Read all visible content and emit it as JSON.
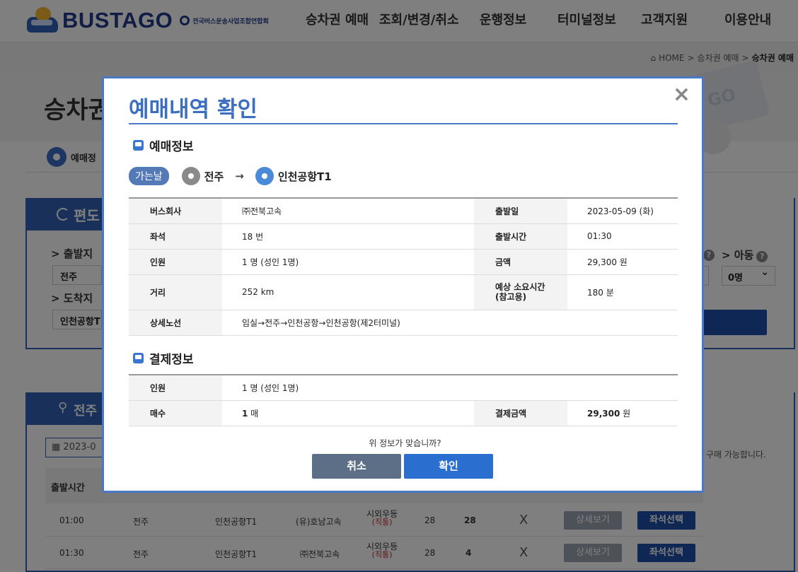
{
  "gnb": {
    "logo_text": "BUSTAGO",
    "logo_sub": "전국버스운송사업조합연합회",
    "menu": [
      "승차권 예매",
      "조회/변경/취소",
      "운행정보",
      "터미널정보",
      "고객지원",
      "이용안내"
    ]
  },
  "breadcrumb": {
    "home": "HOME",
    "level1": "승차권 예매",
    "current": "승차권 예매",
    "sep": ">"
  },
  "hero": {
    "title": "승차권",
    "ticket_text": "GO"
  },
  "step": {
    "label": "예매정"
  },
  "search": {
    "head": "편도",
    "departure_label": "> 출발지",
    "departure_value": "전주",
    "arrival_label": "> 도착지",
    "arrival_value": "인천공항T",
    "child_label": "> 아동",
    "child_select": "0명",
    "help": "?"
  },
  "result": {
    "head": "전주",
    "date_value": "2023-0",
    "note": "구매 가능합니다.",
    "header_first": "출발시간",
    "rows": [
      {
        "time": "01:00",
        "from": "전주",
        "to": "인천공항T1",
        "company": "(유)호남고속",
        "class1": "시외우등",
        "class2": "(직통)",
        "seats": "28",
        "remain": "28",
        "flag": "X",
        "detail": "상세보기",
        "select": "좌석선택"
      },
      {
        "time": "01:30",
        "from": "전주",
        "to": "인천공항T1",
        "company": "㈜전북고속",
        "class1": "시외우등",
        "class2": "(직통)",
        "seats": "28",
        "remain": "4",
        "flag": "X",
        "detail": "상세보기",
        "select": "좌석선택"
      }
    ]
  },
  "modal": {
    "title": "예매내역 확인",
    "close": "×",
    "section1": "예매정보",
    "trip_badge": "가는날",
    "origin": "전주",
    "arrow": "→",
    "destination": "인천공항T1",
    "booking": {
      "company_label": "버스회사",
      "company": "㈜전북고속",
      "date_label": "출발일",
      "date": "2023-05-09 (화)",
      "seat_label": "좌석",
      "seat": "18 번",
      "time_label": "출발시간",
      "time": "01:30",
      "people_label": "인원",
      "people": "1 명 (성인 1명)",
      "price_label": "금액",
      "price": "29,300 원",
      "distance_label": "거리",
      "distance": "252 km",
      "duration_label": "예상 소요시간",
      "duration_label2": "(참고용)",
      "duration": "180 분",
      "route_label": "상세노선",
      "route": "임실→전주→인천공항→인천공항(제2터미널)"
    },
    "section2": "결제정보",
    "payment": {
      "people_label": "인원",
      "people": "1 명 (성인 1명)",
      "count_label": "매수",
      "count": "1",
      "count_unit": " 매",
      "amount_label": "결제금액",
      "amount": "29,300",
      "amount_unit": " 원"
    },
    "question": "위 정보가 맞습니까?",
    "cancel": "취소",
    "confirm": "확인"
  },
  "colors": {
    "brand": "#3060b4",
    "modal_border": "#4a78c6",
    "title": "#3c6fc0",
    "cancel_btn": "#5c6f87",
    "ok_btn": "#2a6fd0"
  }
}
